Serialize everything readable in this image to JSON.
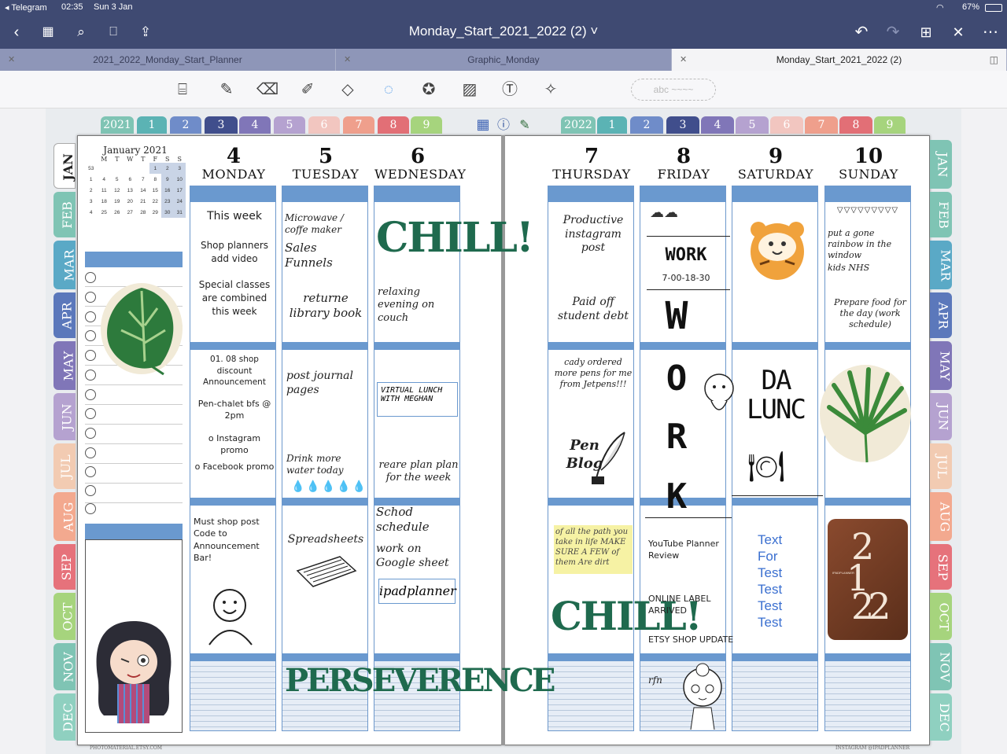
{
  "status": {
    "back_app": "Telegram",
    "time": "02:35",
    "date": "Sun 3 Jan",
    "battery": "67%"
  },
  "nav": {
    "title": "Monday_Start_2021_2022 (2)"
  },
  "tabs": [
    {
      "label": "2021_2022_Monday_Start_Planner"
    },
    {
      "label": "Graphic_Monday"
    },
    {
      "label": "Monday_Start_2021_2022 (2)"
    }
  ],
  "toolbar": {
    "textbox_placeholder": "abc ~~~~"
  },
  "left_year": "2021",
  "right_year": "2022",
  "number_tabs": [
    "1",
    "2",
    "3",
    "4",
    "5",
    "6",
    "7",
    "8",
    "9"
  ],
  "months": [
    "JAN",
    "FEB",
    "MAR",
    "APR",
    "MAY",
    "JUN",
    "JUL",
    "AUG",
    "SEP",
    "OCT",
    "NOV",
    "DEC"
  ],
  "calendar": {
    "title": "January 2021",
    "weekdays": [
      "M",
      "T",
      "W",
      "T",
      "F",
      "S",
      "S"
    ],
    "rows": [
      [
        "53",
        "",
        "",
        "",
        "",
        "1",
        "2",
        "3"
      ],
      [
        "1",
        "4",
        "5",
        "6",
        "7",
        "8",
        "9",
        "10"
      ],
      [
        "2",
        "11",
        "12",
        "13",
        "14",
        "15",
        "16",
        "17"
      ],
      [
        "3",
        "18",
        "19",
        "20",
        "21",
        "22",
        "23",
        "24"
      ],
      [
        "4",
        "25",
        "26",
        "27",
        "28",
        "29",
        "30",
        "31"
      ]
    ]
  },
  "days": [
    {
      "num": "4",
      "name": "Monday"
    },
    {
      "num": "5",
      "name": "Tuesday"
    },
    {
      "num": "6",
      "name": "Wednesday"
    },
    {
      "num": "7",
      "name": "Thursday"
    },
    {
      "num": "8",
      "name": "Friday"
    },
    {
      "num": "9",
      "name": "Saturday"
    },
    {
      "num": "10",
      "name": "Sunday"
    }
  ],
  "notes": {
    "mon_1": "This week",
    "mon_2": "Shop planners add video",
    "mon_3": "Special classes are combined this week",
    "mon_4": "01. 08 shop discount Announcement",
    "mon_5": "Pen-chalet bfs @ 2pm",
    "mon_6": "o Instagram promo",
    "mon_7": "o Facebook promo",
    "mon_8": "Must shop post Code to Announcement Bar!",
    "tue_1": "Microwave / coffe maker",
    "tue_2": "Sales Funnels",
    "tue_3": "returne library book",
    "tue_4": "post journal pages",
    "tue_5": "Drink more water today",
    "tue_6": "Spreadsheets",
    "wed_1": "CHILL!",
    "wed_2": "relaxing evening on couch",
    "wed_3": "VIRTUAL LUNCH WITH MEGHAN",
    "wed_4": "reare plan plan for the week",
    "wed_5": "Schod schedule",
    "wed_6": "work on Google sheet",
    "wed_7": "ipadplanner",
    "perseverence": "PERSEVERENCE",
    "thu_1": "Productive instagram post",
    "thu_2": "Paid off student debt",
    "thu_3": "cady ordered more pens for me from Jetpens!!!",
    "thu_4": "Pen Blog",
    "thu_5": "of all the path you take in life MAKE SURE A FEW of them Are dirt",
    "thu_6": "CHILL!",
    "fri_1": "WORK",
    "fri_2": "7-00-18-30",
    "fri_3": "W",
    "fri_4": "O",
    "fri_5": "R",
    "fri_6": "K",
    "fri_7": "YouTube Planner Review",
    "fri_8": "ONLINE LABEL ARRIVED",
    "fri_9": "ETSY SHOP UPDATE",
    "fri_10": "rfn",
    "sat_1": "DA LUNC",
    "sat_tests": [
      "Text",
      "For",
      "Test",
      "Test",
      "Test",
      "Test"
    ],
    "sun_1": "put a gone rainbow in the window",
    "sun_2": "kids NHS",
    "sun_3": "Prepare food for the day (work schedule)",
    "sun_book_top": "2",
    "sun_book_mid": "1",
    "sun_book_bot": "22",
    "sun_book_label": "IPADPLANNER"
  },
  "footer": {
    "left": "PHOTOMATERIAL.ETSY.COM",
    "right": "INSTAGRAM @IPADPLANNER"
  },
  "colors": {
    "nav": "#3f4a72",
    "column_header": "#6a99cf",
    "chill_green": "#1f6a4e"
  }
}
